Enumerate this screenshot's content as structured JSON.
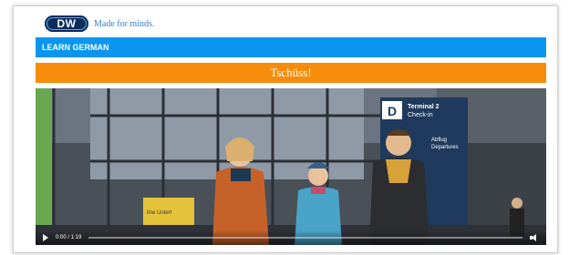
{
  "brand": {
    "logo_text": "DW",
    "tagline": "Made for minds."
  },
  "nav": {
    "section_label": "LEARN GERMAN"
  },
  "lesson": {
    "title": "Tschüss!"
  },
  "video": {
    "time_display": "0:00 / 1:19",
    "progress": 0,
    "sign_terminal": "Terminal 2",
    "sign_checkin": "Check-in",
    "sign_abflug": "Abflug",
    "sign_departures": "Departures",
    "sign_level": "D",
    "poster_text": "line Unterl"
  },
  "colors": {
    "learn_bar": "#0a96f0",
    "title_bar": "#f58c0c",
    "logo": "#0a2d5c"
  }
}
